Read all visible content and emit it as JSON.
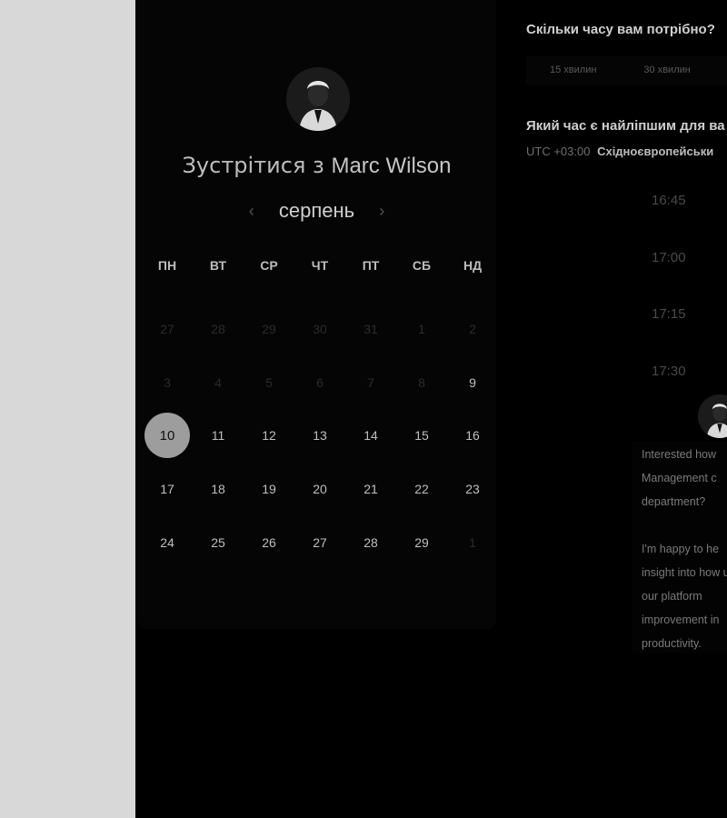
{
  "host": {
    "prefix": "Зустрітися з",
    "name": "Marc Wilson"
  },
  "calendar": {
    "month": "серпень",
    "prev_arrow": "‹",
    "next_arrow": "›",
    "weekdays": [
      "ПН",
      "ВТ",
      "СР",
      "ЧТ",
      "ПТ",
      "СБ",
      "НД"
    ],
    "days": [
      {
        "label": "27",
        "state": "muted"
      },
      {
        "label": "28",
        "state": "muted"
      },
      {
        "label": "29",
        "state": "muted"
      },
      {
        "label": "30",
        "state": "muted"
      },
      {
        "label": "31",
        "state": "muted"
      },
      {
        "label": "1",
        "state": "muted"
      },
      {
        "label": "2",
        "state": "muted"
      },
      {
        "label": "3",
        "state": "muted"
      },
      {
        "label": "4",
        "state": "muted"
      },
      {
        "label": "5",
        "state": "muted"
      },
      {
        "label": "6",
        "state": "muted"
      },
      {
        "label": "7",
        "state": "muted"
      },
      {
        "label": "8",
        "state": "muted"
      },
      {
        "label": "9",
        "state": "available"
      },
      {
        "label": "10",
        "state": "selected"
      },
      {
        "label": "11",
        "state": "available"
      },
      {
        "label": "12",
        "state": "available"
      },
      {
        "label": "13",
        "state": "available"
      },
      {
        "label": "14",
        "state": "available"
      },
      {
        "label": "15",
        "state": "available"
      },
      {
        "label": "16",
        "state": "available"
      },
      {
        "label": "17",
        "state": "available"
      },
      {
        "label": "18",
        "state": "available"
      },
      {
        "label": "19",
        "state": "available"
      },
      {
        "label": "20",
        "state": "available"
      },
      {
        "label": "21",
        "state": "available"
      },
      {
        "label": "22",
        "state": "available"
      },
      {
        "label": "23",
        "state": "available"
      },
      {
        "label": "24",
        "state": "available"
      },
      {
        "label": "25",
        "state": "available"
      },
      {
        "label": "26",
        "state": "available"
      },
      {
        "label": "27",
        "state": "available"
      },
      {
        "label": "28",
        "state": "available"
      },
      {
        "label": "29",
        "state": "available"
      },
      {
        "label": "1",
        "state": "muted"
      }
    ]
  },
  "duration": {
    "question": "Скільки часу вам потрібно?",
    "options": [
      "15 хвилин",
      "30 хвилин"
    ]
  },
  "time": {
    "question": "Який час є найліпшим для ва",
    "tz_offset": "UTC +03:00",
    "tz_name": "Східноєвропейськи",
    "slots": [
      "16:45",
      "17:00",
      "17:15",
      "17:30"
    ]
  },
  "message": {
    "p1": "Interested how Management c department?",
    "p2": "I'm happy to he insight into how use our platform improvement in productivity."
  },
  "colors": {
    "selected_day_bg": "#9d9d9d",
    "page_bg": "#000000",
    "gutter_bg": "#d8d8d8"
  }
}
